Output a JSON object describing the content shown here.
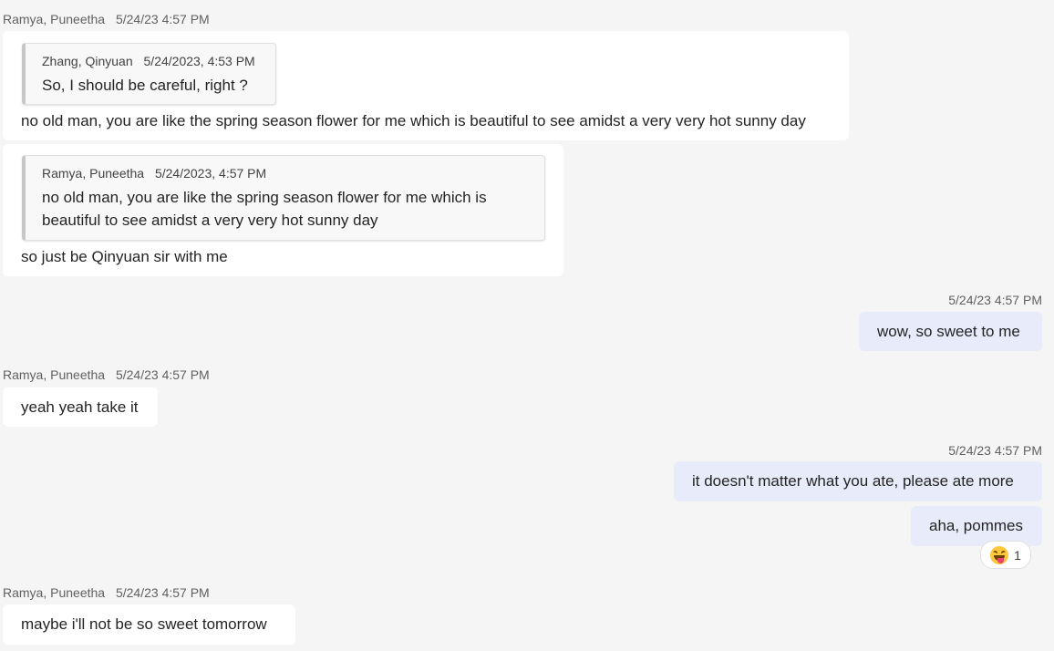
{
  "messages": {
    "m1": {
      "author": "Ramya, Puneetha",
      "time": "5/24/23 4:57 PM",
      "quote": {
        "author": "Zhang, Qinyuan",
        "time": "5/24/2023, 4:53 PM",
        "text": "So, I should be careful, right ?"
      },
      "text": "no old man, you are like the spring season flower for me which is beautiful  to see amidst a very very hot sunny day"
    },
    "m2": {
      "quote": {
        "author": "Ramya, Puneetha",
        "time": "5/24/2023, 4:57 PM",
        "text": "no old man, you are like the spring season flower for me which is beautiful to see amidst a very very hot sunny day"
      },
      "text": "so just be Qinyuan sir with me"
    },
    "m3": {
      "time": "5/24/23 4:57 PM",
      "text": "wow, so sweet to me"
    },
    "m4": {
      "author": "Ramya, Puneetha",
      "time": "5/24/23 4:57 PM",
      "text": "yeah yeah take it"
    },
    "m5": {
      "time": "5/24/23 4:57 PM",
      "text": "it doesn't matter what you ate, please ate more"
    },
    "m6": {
      "text": "aha, pommes",
      "reaction": {
        "icon": "squinting-face-with-tongue-icon",
        "count": "1"
      }
    },
    "m7": {
      "author": "Ramya, Puneetha",
      "time": "5/24/23 4:57 PM",
      "text": "maybe i'll not be so sweet tomorrow"
    }
  },
  "colors": {
    "background": "#f5f5f5",
    "incoming_bubble": "#ffffff",
    "outgoing_bubble": "#e8ebfa",
    "meta_text": "#616161"
  }
}
